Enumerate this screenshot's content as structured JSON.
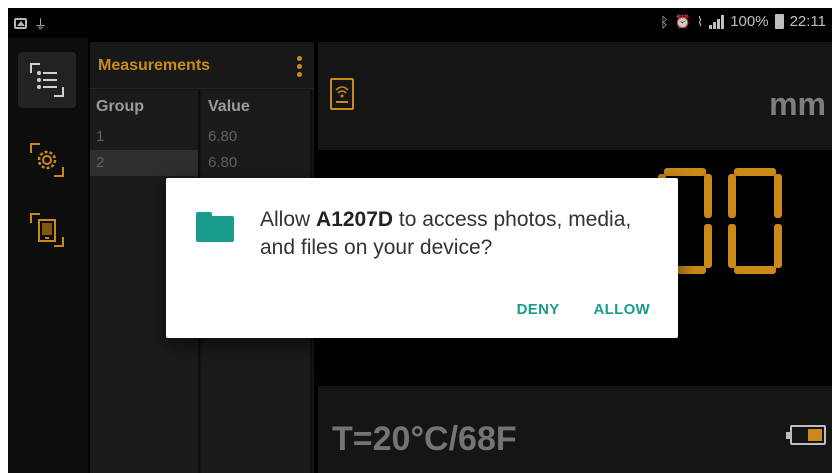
{
  "status_bar": {
    "left_icons": [
      "gallery-notification-icon",
      "usb-notification-icon"
    ],
    "right_icons": [
      "bluetooth-icon",
      "alarm-icon",
      "wifi-icon",
      "signal-icon"
    ],
    "battery_percent": "100%",
    "time": "22:11"
  },
  "rail": {
    "items": [
      {
        "name": "measurements-list-button",
        "icon": "list-icon",
        "active": true
      },
      {
        "name": "settings-button",
        "icon": "gear-icon",
        "active": false
      },
      {
        "name": "device-connect-button",
        "icon": "tablet-wifi-icon",
        "active": false
      }
    ]
  },
  "measurements": {
    "title": "Measurements",
    "columns": [
      "Group",
      "Value"
    ],
    "rows": [
      {
        "group": "1",
        "value": "6.80"
      },
      {
        "group": "2",
        "value": "6.80"
      }
    ],
    "selected_row": 2
  },
  "display": {
    "unit": "mm",
    "temperature": "T=20°C/68F",
    "battery_level": "low",
    "accent_color": "#f7a81f"
  },
  "dialog": {
    "message_prefix": "Allow ",
    "app_name": "A1207D",
    "message_suffix": " to access photos, media, and files on your device?",
    "deny_label": "DENY",
    "allow_label": "ALLOW",
    "accent_color": "#1a9c8c",
    "icon": "folder-icon"
  }
}
